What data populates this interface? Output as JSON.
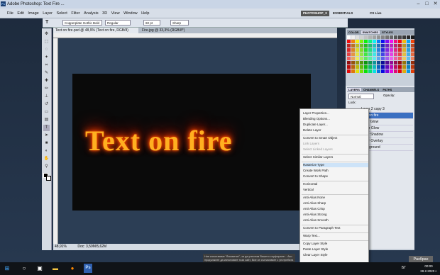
{
  "window": {
    "title": "Adobe Photoshop: Text Fire ...",
    "min": "–",
    "max": "□",
    "close": "✕"
  },
  "menu": [
    "File",
    "Edit",
    "Image",
    "Layer",
    "Select",
    "Filter",
    "Analysis",
    "3D",
    "View",
    "Window",
    "Help"
  ],
  "workspace": {
    "active": "PHOTOSHOP_3",
    "essentials": "ESSENTIALS",
    "cslive": "CS Live"
  },
  "options": {
    "font": "Copperplate Gothic Bold",
    "style": "Regular",
    "size": "60 pt",
    "aa": "Sharp"
  },
  "tabs": [
    "Text on fire.psd @ 48,9% (Text on fire, RGB/8)",
    "Fire.jpg @ 33,3% (RGB/8*)"
  ],
  "canvas": {
    "text": "Text on fire"
  },
  "status": {
    "zoom": "48,91%",
    "doc": "Doc: 3,59M/5,62M"
  },
  "panels": {
    "color": "COLOR",
    "swatches": "SWATCHES",
    "styles": "STYLES",
    "layers": "LAYERS",
    "channels": "CHANNELS",
    "paths": "PATHS",
    "blend": "Normal",
    "opacity": "Opacity:",
    "lock": "Lock:",
    "layer_rows": [
      "Layer 2 copy 3",
      "Text on fire",
      "Inner Glow",
      "Outer Glow",
      "Inner Shadow",
      "Color Overlay",
      "Background"
    ]
  },
  "context_menu": [
    "Layer Properties...",
    "Blending Options...",
    "Duplicate Layer...",
    "Delete Layer",
    "Convert to Smart Object",
    "Link Layers",
    "Select Linked Layers",
    "Select Similar Layers",
    "Rasterize Type",
    "Create Work Path",
    "Convert to Shape",
    "Horizontal",
    "Vertical",
    "Anti-Alias None",
    "Anti-Alias Sharp",
    "Anti-Alias Crisp",
    "Anti-Alias Strong",
    "Anti-Alias Smooth",
    "Convert to Paragraph Text",
    "Warp Text...",
    "Copy Layer Style",
    "Paste Layer Style",
    "Clear Layer Style"
  ],
  "notice": {
    "text": "Ние използваме \"бисквитки\", за да улесним Вашето сърфиране... Ако продължите да използвате този сайт, Вие се съгласявате с употребата на \"бисквитки\".",
    "button": "Разбрах"
  },
  "taskbar": {
    "time": "00:00",
    "date": "28.2.2020 г.",
    "lang": "БГ"
  },
  "colors": {
    "fire": "#ffb020",
    "menu_highlight": "#cde3f8"
  },
  "icons": [
    "windows-start-icon",
    "search-icon",
    "task-view-icon",
    "file-explorer-icon",
    "firefox-icon",
    "chrome-icon",
    "photoshop-icon"
  ]
}
